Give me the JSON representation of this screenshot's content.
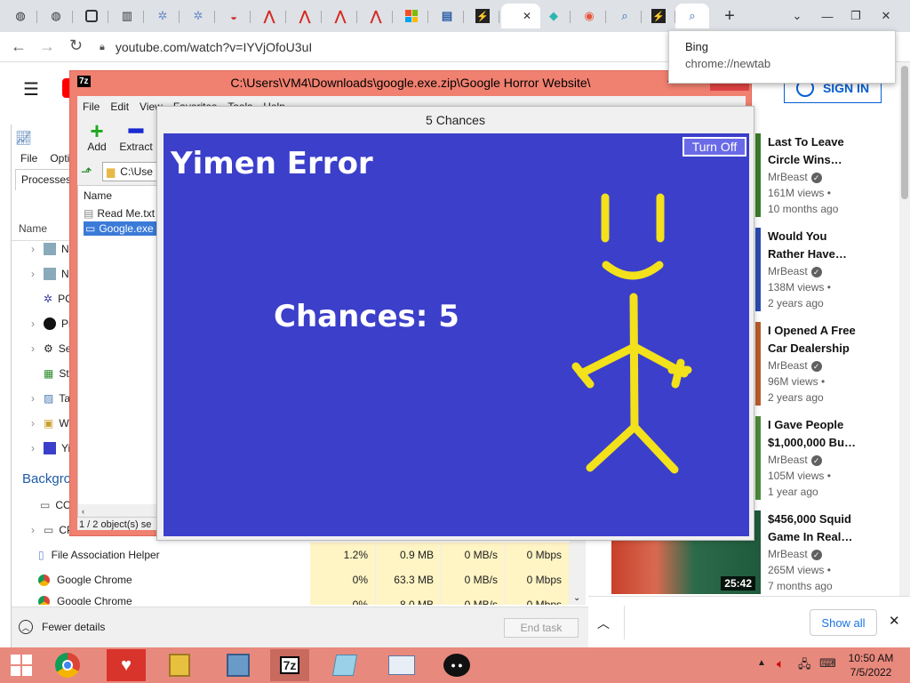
{
  "browser": {
    "url": "youtube.com/watch?v=IYVjOfoU3uI",
    "new_tab_symbol": "+",
    "bing_popup": {
      "title": "Bing",
      "subtitle": "chrome://newtab"
    },
    "tab_close": "✕"
  },
  "youtube": {
    "sign_in": "SIGN IN",
    "show_all": "Show all",
    "duration": "25:42",
    "videos": [
      {
        "title1": "Last To Leave",
        "title2": "Circle Wins…",
        "channel": "MrBeast",
        "views": "161M views •",
        "age": "10 months ago"
      },
      {
        "title1": "Would You",
        "title2": "Rather Have…",
        "channel": "MrBeast",
        "views": "138M views •",
        "age": "2 years ago"
      },
      {
        "title1": "I Opened A Free",
        "title2": "Car Dealership",
        "channel": "MrBeast",
        "views": "96M views •",
        "age": "2 years ago"
      },
      {
        "title1": "I Gave People",
        "title2": "$1,000,000 Bu…",
        "channel": "MrBeast",
        "views": "105M views •",
        "age": "1 year ago"
      },
      {
        "title1": "$456,000 Squid",
        "title2": "Game In Real…",
        "channel": "MrBeast",
        "views": "265M views •",
        "age": "7 months ago"
      }
    ]
  },
  "taskmgr": {
    "menu": [
      "File",
      "Optio"
    ],
    "tab": "Processes",
    "col_name": "Name",
    "apps": [
      "No",
      "No",
      "PC",
      "Pin",
      "Se",
      "Sto",
      "Ta",
      "Wi",
      "Yin"
    ],
    "background_heading": "Backgro",
    "bg_partial": [
      "CO",
      "CP"
    ],
    "rows": [
      {
        "name": "File Association Helper",
        "cpu": "1.2%",
        "mem": "0.9 MB",
        "disk": "0 MB/s",
        "net": "0 Mbps"
      },
      {
        "name": "Google Chrome",
        "cpu": "0%",
        "mem": "63.3 MB",
        "disk": "0 MB/s",
        "net": "0 Mbps"
      },
      {
        "name": "Google Chrome",
        "cpu": "0%",
        "mem": "8.0 MB",
        "disk": "0 MB/s",
        "net": "0 Mbps"
      }
    ],
    "fewer_details": "Fewer details",
    "end_task": "End task"
  },
  "sevenzip": {
    "title": "C:\\Users\\VM4\\Downloads\\google.exe.zip\\Google Horror Website\\",
    "app_icon": "7z",
    "menu": [
      "File",
      "Edit",
      "View",
      "Favorites",
      "Tools",
      "Help"
    ],
    "toolbar": {
      "add": "Add",
      "extract": "Extract"
    },
    "path": "C:\\Use",
    "col_name": "Name",
    "files": [
      "Read Me.txt",
      "Google.exe"
    ],
    "status": "1 / 2 object(s) se"
  },
  "game": {
    "window_title": "5 Chances",
    "heading": "Yimen Error",
    "turn_off": "Turn Off",
    "chances": "Chances: 5",
    "colors": {
      "bg": "#3b3fca",
      "stick": "#f2e11b"
    }
  },
  "taskbar": {
    "time": "10:50 AM",
    "date": "7/5/2022",
    "items": [
      "start-icon",
      "chrome-icon",
      "ice-cream-icon",
      "archive-icon",
      "installer-icon",
      "7zip-icon",
      "notepad-icon",
      "task-manager-icon",
      "penguin-icon"
    ],
    "sevenzip_label": "7z"
  }
}
